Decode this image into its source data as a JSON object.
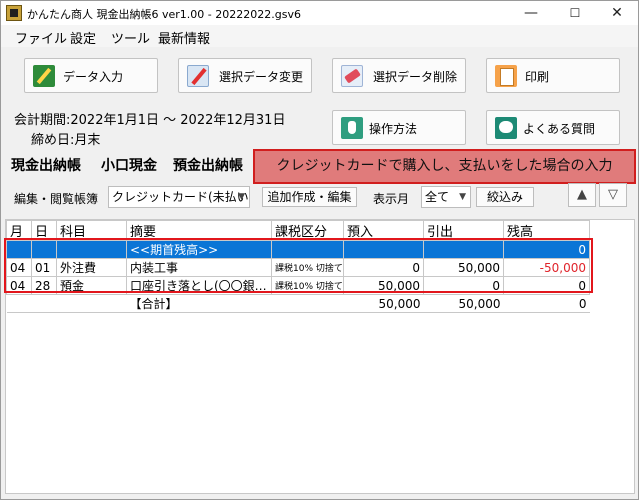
{
  "window": {
    "title": "かんたん商人 現金出納帳6 ver1.00 - 20222022.gsv6",
    "minimize": "—",
    "maximize": "☐",
    "close": "✕"
  },
  "menu": [
    "ファイル",
    "設定",
    "ツール",
    "最新情報"
  ],
  "buttons": {
    "data_entry": "データ入力",
    "data_edit": "選択データ変更",
    "data_delete": "選択データ削除",
    "print": "印刷",
    "how_to": "操作方法",
    "faq": "よくある質問"
  },
  "info": {
    "period": "会計期間:2022年1月1日 〜 2022年12月31日",
    "closing": "締め日:月末"
  },
  "book_tabs": [
    "現金出納帳",
    "小口現金",
    "預金出納帳"
  ],
  "tooltip": "クレジットカードで購入し、支払いをした場合の入力",
  "filter": {
    "book_label": "編集・閲覧帳簿",
    "book_value": "クレジットカード(未払い金",
    "add_button": "追加作成・編集",
    "month_label": "表示月",
    "month_value": "全て",
    "narrow_button": "絞込み",
    "up_button": "▲",
    "down_button": "▽"
  },
  "table": {
    "headers": [
      "月",
      "日",
      "科目",
      "摘要",
      "課税区分",
      "預入",
      "引出",
      "残高"
    ],
    "opening": {
      "summary": "<<期首残高>>",
      "balance": "0"
    },
    "rows": [
      {
        "month": "04",
        "day": "01",
        "account": "外注費",
        "summary": "内装工事",
        "tax": "課税10% 切捨て",
        "deposit": "0",
        "withdrawal": "50,000",
        "balance": "-50,000"
      },
      {
        "month": "04",
        "day": "28",
        "account": "預金",
        "summary": "口座引き落とし(〇〇銀…",
        "tax": "課税10% 切捨て",
        "deposit": "50,000",
        "withdrawal": "0",
        "balance": "0"
      }
    ],
    "total": {
      "label": "【合計】",
      "deposit": "50,000",
      "withdrawal": "50,000",
      "balance": "0"
    }
  },
  "colors": {
    "selected_row": "#0a75d6",
    "highlight_border": "#e2161c",
    "tooltip_bg": "#e07b7b",
    "negative": "#e0242b"
  }
}
